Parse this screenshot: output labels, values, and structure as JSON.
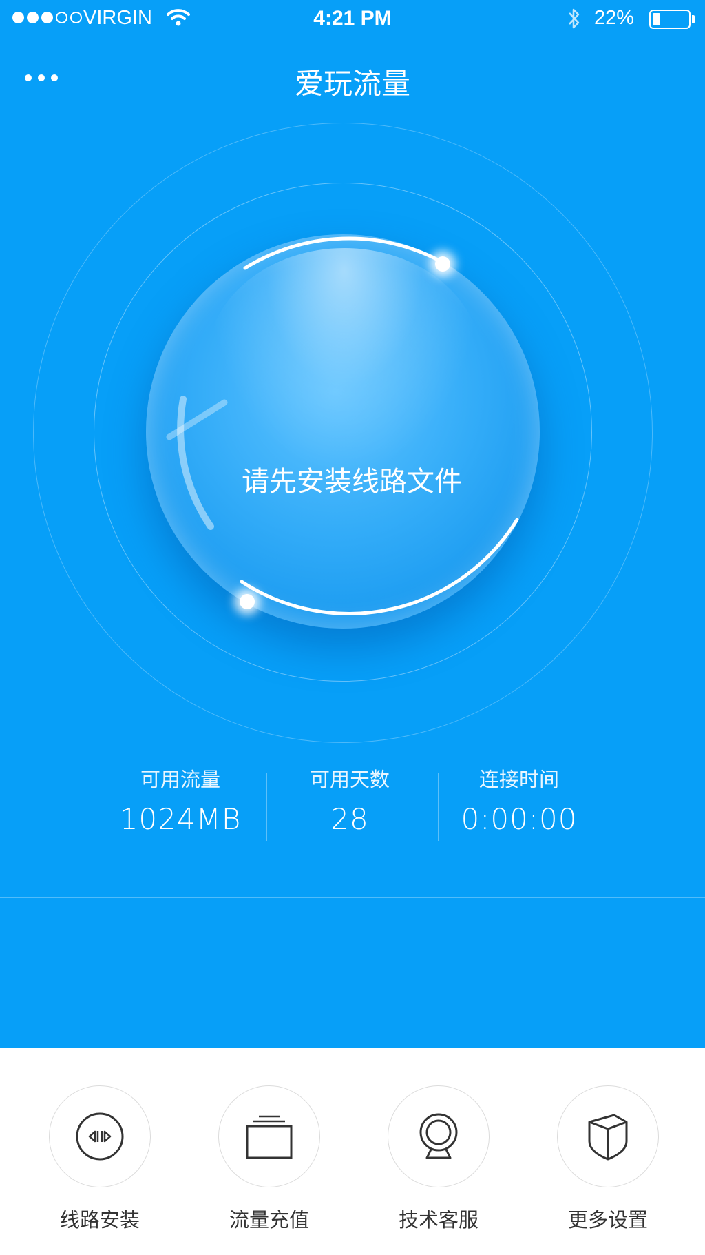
{
  "status_bar": {
    "signal_dots": [
      true,
      true,
      true,
      false,
      false
    ],
    "carrier": "VIRGIN",
    "time": "4:21 PM",
    "battery_percent": "22%",
    "battery_level": 0.22
  },
  "nav": {
    "title": "爱玩流量",
    "more_icon": "more-dots-icon"
  },
  "ball": {
    "text": "请先安装线路文件"
  },
  "stats": [
    {
      "label": "可用流量",
      "value": "1024MB"
    },
    {
      "label": "可用天数",
      "value": "28"
    },
    {
      "label": "连接时间",
      "value": "0:00:00"
    }
  ],
  "menu": [
    {
      "label": "线路安装",
      "icon": "route-install-icon"
    },
    {
      "label": "流量充值",
      "icon": "recharge-cards-icon"
    },
    {
      "label": "技术客服",
      "icon": "webcam-support-icon"
    },
    {
      "label": "更多设置",
      "icon": "shield-settings-icon"
    }
  ],
  "colors": {
    "primary_blue": "#079ff8",
    "menu_text": "#333333",
    "menu_border": "#dcdcdc"
  }
}
